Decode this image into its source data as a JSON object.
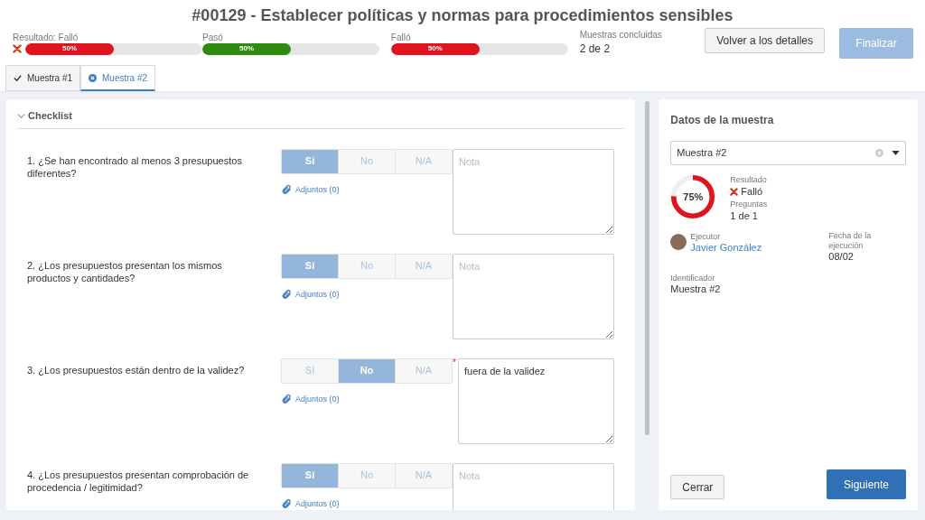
{
  "header": {
    "title": "#00129 - Establecer políticas y normas para procedimientos sensibles",
    "result": {
      "label": "Resultado: Falló",
      "failed": true,
      "level": 0.5,
      "reading": "50%",
      "color": "#e0141e"
    },
    "bars": [
      {
        "label": "Pasó",
        "level": 0.5,
        "reading": "50%",
        "color": "#2e8b0f"
      },
      {
        "label": "Falló",
        "level": 0.5,
        "reading": "50%",
        "color": "#e0141e"
      }
    ],
    "samples_done": {
      "label": "Muestras concluidas",
      "value": "2 de 2"
    },
    "buttons": [
      {
        "label": "Volver a los detalles",
        "kind": "secondary",
        "disabled": false
      },
      {
        "label": "Finalizar",
        "kind": "primary",
        "disabled": true
      }
    ]
  },
  "tabs": [
    {
      "label": "Muestra #1",
      "kind": "passed",
      "selected": false
    },
    {
      "label": "Muestra #2",
      "kind": "failed",
      "selected": true
    }
  ],
  "checklist": {
    "title": "Checklist",
    "expanded": true,
    "questions": [
      {
        "text": "1. ¿Se han encontrado al menos 3 presupuestos diferentes?",
        "options": [
          {
            "label": "Sí",
            "selected": true
          },
          {
            "label": "No",
            "selected": false
          },
          {
            "label": "N/A",
            "selected": false
          }
        ],
        "attachments": "Adjuntos (0)",
        "note": {
          "placeholder": "Nota",
          "required": false
        }
      },
      {
        "text": "2. ¿Los presupuestos presentan los mismos productos y cantidades?",
        "options": [
          {
            "label": "Sí",
            "selected": true
          },
          {
            "label": "No",
            "selected": false
          },
          {
            "label": "N/A",
            "selected": false
          }
        ],
        "attachments": "Adjuntos (0)",
        "note": {
          "placeholder": "Nota",
          "required": false
        }
      },
      {
        "text": "3. ¿Los presupuestos están dentro de la validez?",
        "options": [
          {
            "label": "Sí",
            "selected": false
          },
          {
            "label": "No",
            "selected": true
          },
          {
            "label": "N/A",
            "selected": false
          }
        ],
        "attachments": "Adjuntos (0)",
        "note": {
          "value": "fuera de la validez",
          "required": true,
          "required_mark": "*"
        }
      },
      {
        "text": "4. ¿Los presupuestos presentan comprobación de procedencia / legitimidad?",
        "options": [
          {
            "label": "Sí",
            "selected": true
          },
          {
            "label": "No",
            "selected": false
          },
          {
            "label": "N/A",
            "selected": false
          }
        ],
        "attachments": "Adjuntos (0)",
        "note": {
          "placeholder": "Nota",
          "required": false
        }
      }
    ]
  },
  "sample_panel": {
    "title": "Datos de la muestra",
    "select": {
      "value": "Muestra #2"
    },
    "score": {
      "level": 0.75,
      "reading": "75%"
    },
    "result": {
      "label": "Resultado",
      "value": "Falló",
      "failed": true
    },
    "questions": {
      "label": "Preguntas",
      "value": "1 de 1"
    },
    "executor": {
      "label": "Ejecutor",
      "name": "Javier González"
    },
    "date": {
      "label": "Fecha de la ejecución",
      "value": "08/02"
    },
    "identifier": {
      "label": "Identificador",
      "value": "Muestra #2"
    },
    "buttons": [
      {
        "label": "Cerrar",
        "kind": "secondary"
      },
      {
        "label": "Siguiente",
        "kind": "primary"
      }
    ]
  }
}
